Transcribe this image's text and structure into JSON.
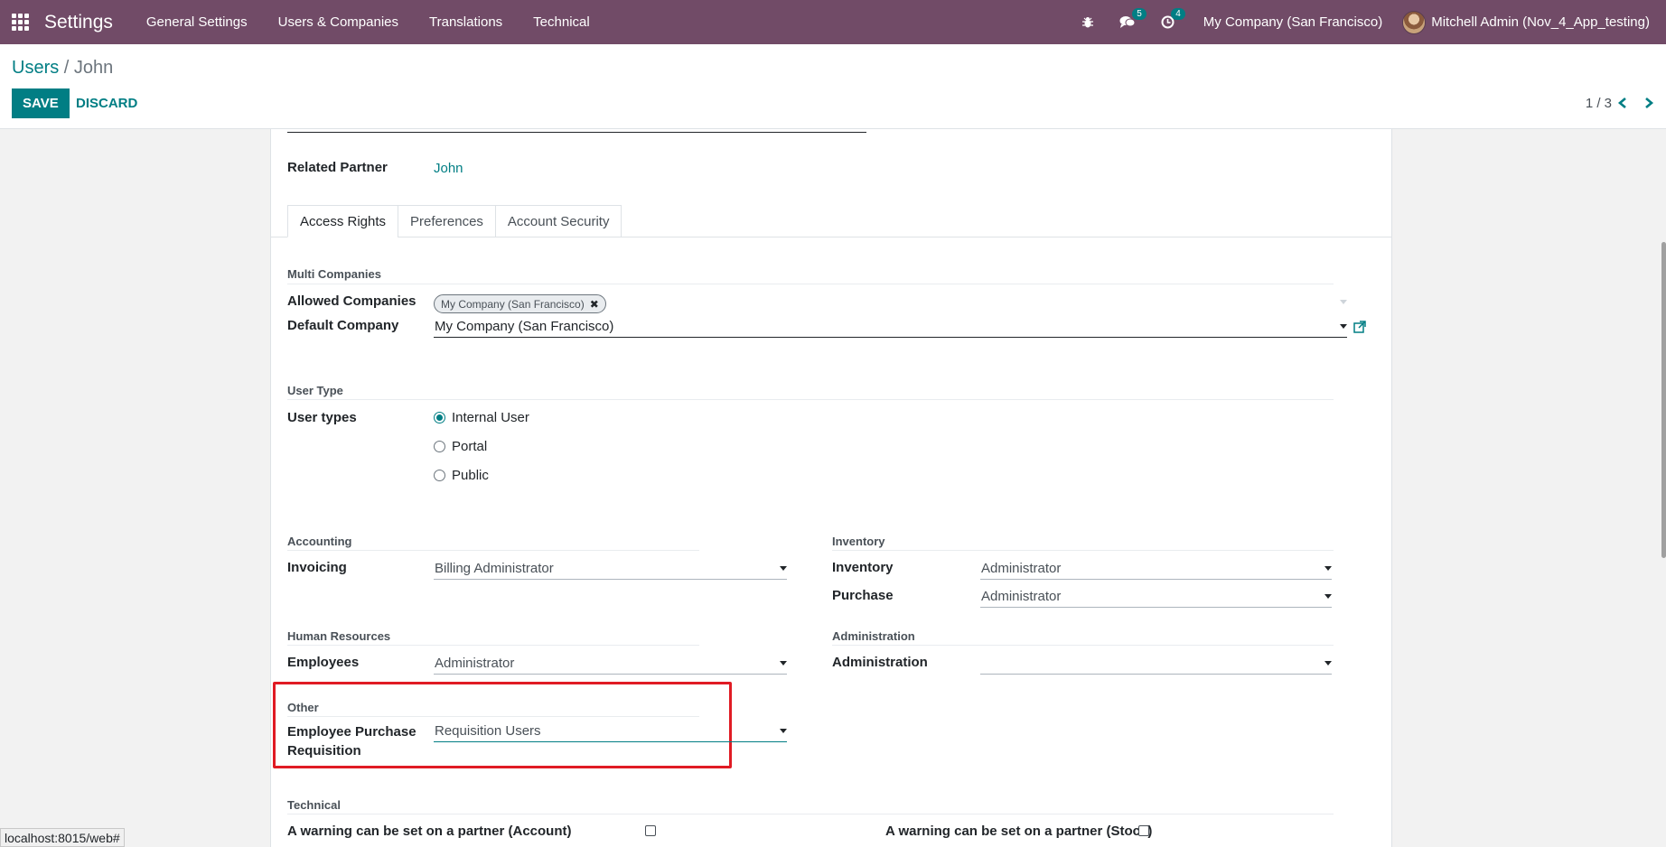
{
  "navbar": {
    "app_name": "Settings",
    "menu": [
      "General Settings",
      "Users & Companies",
      "Translations",
      "Technical"
    ],
    "chat_count": "5",
    "activity_count": "4",
    "company": "My Company (San Francisco)",
    "user": "Mitchell Admin (Nov_4_App_testing)"
  },
  "control": {
    "breadcrumb_parent": "Users",
    "breadcrumb_sep": "/",
    "breadcrumb_current": "John",
    "save_label": "SAVE",
    "discard_label": "DISCARD",
    "pager": "1 / 3"
  },
  "form": {
    "related_partner_label": "Related Partner",
    "related_partner_value": "John",
    "tabs": [
      "Access Rights",
      "Preferences",
      "Account Security"
    ],
    "multi_companies": {
      "title": "Multi Companies",
      "allowed_label": "Allowed Companies",
      "allowed_tag": "My Company (San Francisco)",
      "default_label": "Default Company",
      "default_value": "My Company (San Francisco)"
    },
    "user_type": {
      "title": "User Type",
      "label": "User types",
      "options": [
        "Internal User",
        "Portal",
        "Public"
      ],
      "selected": "Internal User"
    },
    "accounting": {
      "title": "Accounting",
      "invoicing_label": "Invoicing",
      "invoicing_value": "Billing Administrator"
    },
    "inventory": {
      "title": "Inventory",
      "inventory_label": "Inventory",
      "inventory_value": "Administrator",
      "purchase_label": "Purchase",
      "purchase_value": "Administrator"
    },
    "human_resources": {
      "title": "Human Resources",
      "employees_label": "Employees",
      "employees_value": "Administrator"
    },
    "administration": {
      "title": "Administration",
      "administration_label": "Administration",
      "administration_value": ""
    },
    "other": {
      "title": "Other",
      "epr_label_line1": "Employee Purchase",
      "epr_label_line2": "Requisition",
      "epr_value": "Requisition Users"
    },
    "technical": {
      "title": "Technical",
      "warning_account": "A warning can be set on a partner (Account)",
      "warning_stock": "A warning can be set on a partner (Stock)"
    }
  },
  "status_bar_url": "localhost:8015/web#",
  "colors": {
    "navbar": "#714b67",
    "accent": "#017e84",
    "highlight": "#e01b24"
  }
}
